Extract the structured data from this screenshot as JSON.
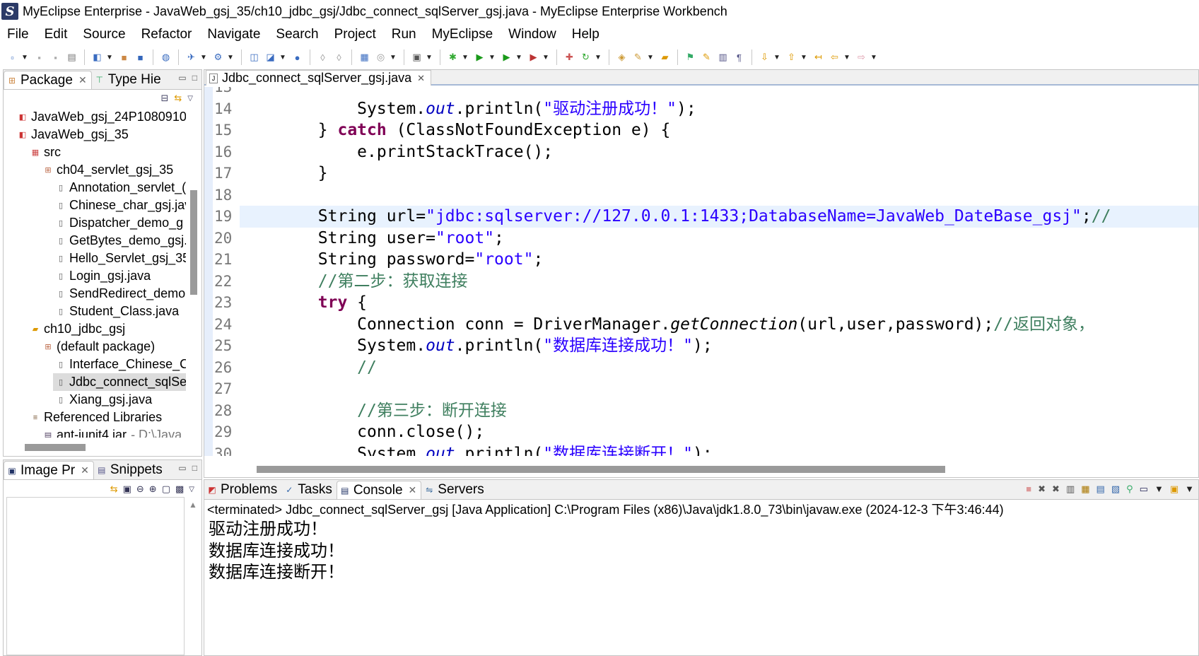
{
  "window": {
    "title": "MyEclipse Enterprise - JavaWeb_gsj_35/ch10_jdbc_gsj/Jdbc_connect_sqlServer_gsj.java - MyEclipse Enterprise Workbench"
  },
  "menu": [
    "File",
    "Edit",
    "Source",
    "Refactor",
    "Navigate",
    "Search",
    "Project",
    "Run",
    "MyEclipse",
    "Window",
    "Help"
  ],
  "package_explorer": {
    "tabs": [
      {
        "label": "Package",
        "icon": "package-explorer-icon"
      },
      {
        "label": "Type Hie",
        "icon": "type-hierarchy-icon"
      }
    ],
    "tree": [
      {
        "label": "JavaWeb_gsj_24P1080910",
        "indent": 1,
        "icon": "project-icon"
      },
      {
        "label": "JavaWeb_gsj_35",
        "indent": 1,
        "icon": "project-icon"
      },
      {
        "label": "src",
        "indent": 2,
        "icon": "source-folder-icon"
      },
      {
        "label": "ch04_servlet_gsj_35",
        "indent": 3,
        "icon": "package-icon"
      },
      {
        "label": "Annotation_servlet_(",
        "indent": 4,
        "icon": "java-file-icon"
      },
      {
        "label": "Chinese_char_gsj.jav",
        "indent": 4,
        "icon": "java-file-icon"
      },
      {
        "label": "Dispatcher_demo_g",
        "indent": 4,
        "icon": "java-file-icon"
      },
      {
        "label": "GetBytes_demo_gsj.",
        "indent": 4,
        "icon": "java-file-icon"
      },
      {
        "label": "Hello_Servlet_gsj_35",
        "indent": 4,
        "icon": "java-file-icon"
      },
      {
        "label": "Login_gsj.java",
        "indent": 4,
        "icon": "java-file-icon"
      },
      {
        "label": "SendRedirect_demo",
        "indent": 4,
        "icon": "java-file-icon"
      },
      {
        "label": "Student_Class.java",
        "indent": 4,
        "icon": "java-file-icon"
      },
      {
        "label": "ch10_jdbc_gsj",
        "indent": 2,
        "icon": "folder-icon"
      },
      {
        "label": "(default package)",
        "indent": 3,
        "icon": "package-icon"
      },
      {
        "label": "Interface_Chinese_Cl",
        "indent": 4,
        "icon": "java-file-icon"
      },
      {
        "label": "Jdbc_connect_sqlSer",
        "indent": 4,
        "icon": "java-file-icon",
        "selected": true
      },
      {
        "label": "Xiang_gsj.java",
        "indent": 4,
        "icon": "java-file-icon"
      },
      {
        "label": "Referenced Libraries",
        "indent": 2,
        "icon": "library-icon"
      },
      {
        "label": "ant-junit4.jar",
        "indent": 3,
        "icon": "jar-icon",
        "suffix": "- D:\\Java"
      }
    ]
  },
  "image_preview": {
    "tabs": [
      {
        "label": "Image Pr",
        "icon": "image-preview-icon"
      },
      {
        "label": "Snippets",
        "icon": "snippets-icon"
      }
    ]
  },
  "editor": {
    "tab_label": "Jdbc_connect_sqlServer_gsj.java",
    "current_line": 19,
    "lines": [
      {
        "num": "13",
        "tokens": [
          {
            "t": "            Class.forName(db_str);//通过字节码文件，直接加载类",
            "c": "partial"
          }
        ]
      },
      {
        "num": "14",
        "tokens": [
          {
            "t": "            System."
          },
          {
            "t": "out",
            "c": "fld"
          },
          {
            "t": ".println("
          },
          {
            "t": "\"驱动注册成功！\"",
            "c": "str"
          },
          {
            "t": ");"
          }
        ]
      },
      {
        "num": "15",
        "tokens": [
          {
            "t": "        } "
          },
          {
            "t": "catch",
            "c": "kw"
          },
          {
            "t": " (ClassNotFoundException e) {"
          }
        ]
      },
      {
        "num": "16",
        "tokens": [
          {
            "t": "            e.printStackTrace();"
          }
        ]
      },
      {
        "num": "17",
        "tokens": [
          {
            "t": "        }"
          }
        ]
      },
      {
        "num": "18",
        "tokens": [
          {
            "t": ""
          }
        ]
      },
      {
        "num": "19",
        "tokens": [
          {
            "t": "        String url="
          },
          {
            "t": "\"jdbc:sqlserver://127.0.0.1:1433;DatabaseName=JavaWeb_DateBase_gsj\"",
            "c": "str"
          },
          {
            "t": ";"
          },
          {
            "t": "//",
            "c": "cmt"
          }
        ]
      },
      {
        "num": "20",
        "tokens": [
          {
            "t": "        String user="
          },
          {
            "t": "\"root\"",
            "c": "str"
          },
          {
            "t": ";"
          }
        ]
      },
      {
        "num": "21",
        "tokens": [
          {
            "t": "        String password="
          },
          {
            "t": "\"root\"",
            "c": "str"
          },
          {
            "t": ";"
          }
        ]
      },
      {
        "num": "22",
        "tokens": [
          {
            "t": "        "
          },
          {
            "t": "//第二步：获取连接",
            "c": "cmt"
          }
        ]
      },
      {
        "num": "23",
        "tokens": [
          {
            "t": "        "
          },
          {
            "t": "try",
            "c": "kw"
          },
          {
            "t": " {"
          }
        ]
      },
      {
        "num": "24",
        "tokens": [
          {
            "t": "            Connection conn = DriverManager."
          },
          {
            "t": "getConnection",
            "c": "itl"
          },
          {
            "t": "(url,user,password);"
          },
          {
            "t": "//返回对象，",
            "c": "cmt"
          }
        ]
      },
      {
        "num": "25",
        "tokens": [
          {
            "t": "            System."
          },
          {
            "t": "out",
            "c": "fld"
          },
          {
            "t": ".println("
          },
          {
            "t": "\"数据库连接成功！\"",
            "c": "str"
          },
          {
            "t": ");"
          }
        ]
      },
      {
        "num": "26",
        "tokens": [
          {
            "t": "            "
          },
          {
            "t": "//",
            "c": "cmt"
          }
        ]
      },
      {
        "num": "27",
        "tokens": [
          {
            "t": ""
          }
        ]
      },
      {
        "num": "28",
        "tokens": [
          {
            "t": "            "
          },
          {
            "t": "//第三步：断开连接",
            "c": "cmt"
          }
        ]
      },
      {
        "num": "29",
        "tokens": [
          {
            "t": "            conn.close();"
          }
        ]
      },
      {
        "num": "30",
        "tokens": [
          {
            "t": "            System."
          },
          {
            "t": "out",
            "c": "fld"
          },
          {
            "t": ".println("
          },
          {
            "t": "\"数据库连接断开！\"",
            "c": "str"
          },
          {
            "t": ");"
          }
        ]
      }
    ]
  },
  "console": {
    "tabs": [
      {
        "label": "Problems",
        "icon": "problems-icon",
        "active": false
      },
      {
        "label": "Tasks",
        "icon": "tasks-icon",
        "active": false
      },
      {
        "label": "Console",
        "icon": "console-icon",
        "active": true
      },
      {
        "label": "Servers",
        "icon": "servers-icon",
        "active": false
      }
    ],
    "status": "<terminated> Jdbc_connect_sqlServer_gsj [Java Application] C:\\Program Files (x86)\\Java\\jdk1.8.0_73\\bin\\javaw.exe (2024-12-3 下午3:46:44)",
    "output": [
      "驱动注册成功！",
      "数据库连接成功！",
      "数据库连接断开！"
    ]
  },
  "colors": {
    "keyword": "#7f0055",
    "string": "#2a00ff",
    "static_field": "#0000c0",
    "comment": "#3f7f5f",
    "current_line": "#e8f2fe"
  }
}
